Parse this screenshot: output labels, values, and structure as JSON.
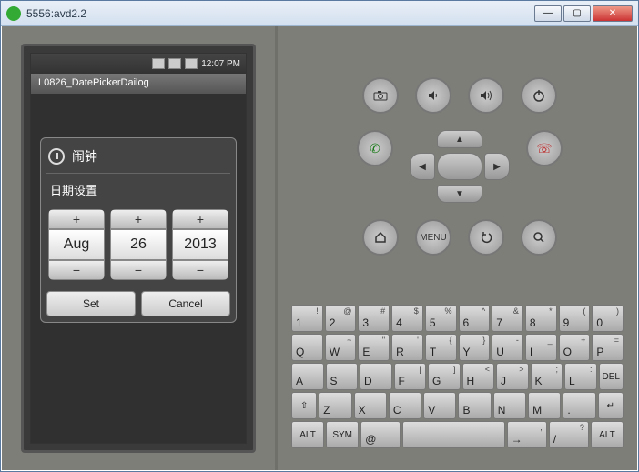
{
  "window": {
    "title": "5556:avd2.2"
  },
  "statusbar": {
    "time": "12:07 PM"
  },
  "app": {
    "title": "L0826_DatePickerDailog"
  },
  "dialog": {
    "title": "闹钟",
    "subtitle": "日期设置",
    "month": "Aug",
    "day": "26",
    "year": "2013",
    "set": "Set",
    "cancel": "Cancel"
  },
  "ctrl": {
    "menu": "MENU"
  },
  "kbd": {
    "r1": [
      {
        "m": "1",
        "s": "!"
      },
      {
        "m": "2",
        "s": "@"
      },
      {
        "m": "3",
        "s": "#"
      },
      {
        "m": "4",
        "s": "$"
      },
      {
        "m": "5",
        "s": "%"
      },
      {
        "m": "6",
        "s": "^"
      },
      {
        "m": "7",
        "s": "&"
      },
      {
        "m": "8",
        "s": "*"
      },
      {
        "m": "9",
        "s": "("
      },
      {
        "m": "0",
        "s": ")"
      }
    ],
    "r2": [
      {
        "m": "Q",
        "s": ""
      },
      {
        "m": "W",
        "s": "~"
      },
      {
        "m": "E",
        "s": "\""
      },
      {
        "m": "R",
        "s": "'"
      },
      {
        "m": "T",
        "s": "{"
      },
      {
        "m": "Y",
        "s": "}"
      },
      {
        "m": "U",
        "s": "-"
      },
      {
        "m": "I",
        "s": "_"
      },
      {
        "m": "O",
        "s": "+"
      },
      {
        "m": "P",
        "s": "="
      }
    ],
    "r3": [
      {
        "m": "A",
        "s": ""
      },
      {
        "m": "S",
        "s": ""
      },
      {
        "m": "D",
        "s": ""
      },
      {
        "m": "F",
        "s": "["
      },
      {
        "m": "G",
        "s": "]"
      },
      {
        "m": "H",
        "s": "<"
      },
      {
        "m": "J",
        "s": ">"
      },
      {
        "m": "K",
        "s": ";"
      },
      {
        "m": "L",
        "s": ":"
      }
    ],
    "r4": [
      {
        "m": "Z",
        "s": ""
      },
      {
        "m": "X",
        "s": ""
      },
      {
        "m": "C",
        "s": ""
      },
      {
        "m": "V",
        "s": ""
      },
      {
        "m": "B",
        "s": ""
      },
      {
        "m": "N",
        "s": ""
      },
      {
        "m": "M",
        "s": ""
      },
      {
        "m": ".",
        "s": ""
      }
    ],
    "alt": "ALT",
    "sym": "SYM",
    "at": "@",
    "del": "DEL",
    "shift": "⇧",
    "enter": "↵",
    "arrow": "→",
    "slash": "/",
    "comma": ",",
    "q": "?"
  }
}
